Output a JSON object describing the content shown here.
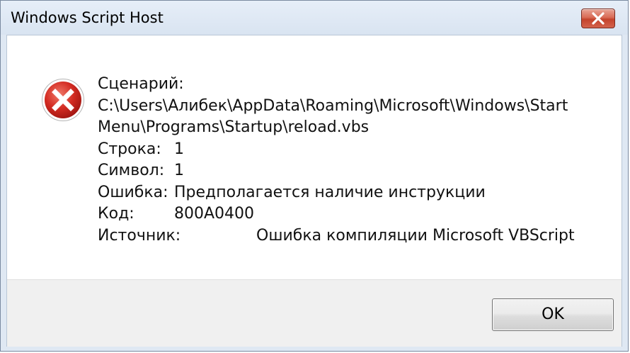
{
  "window": {
    "title": "Windows Script Host",
    "close_icon": "close-icon"
  },
  "message": {
    "icon": "error-icon",
    "script_label": "Сценарий:",
    "script_path_line1": "C:\\Users\\Алибек\\AppData\\Roaming\\Microsoft\\Windows\\Start",
    "script_path_line2": "Menu\\Programs\\Startup\\reload.vbs",
    "line_label": "Строка:",
    "line_value": "1",
    "char_label": "Символ:",
    "char_value": "1",
    "error_label": "Ошибка:",
    "error_value": "Предполагается наличие инструкции",
    "code_label": "Код:",
    "code_value": "800A0400",
    "source_label": "Источник:",
    "source_value": "Ошибка компиляции Microsoft VBScript"
  },
  "buttons": {
    "ok_label": "OK"
  },
  "colors": {
    "error_red": "#d32b22",
    "close_red": "#c4432c"
  }
}
